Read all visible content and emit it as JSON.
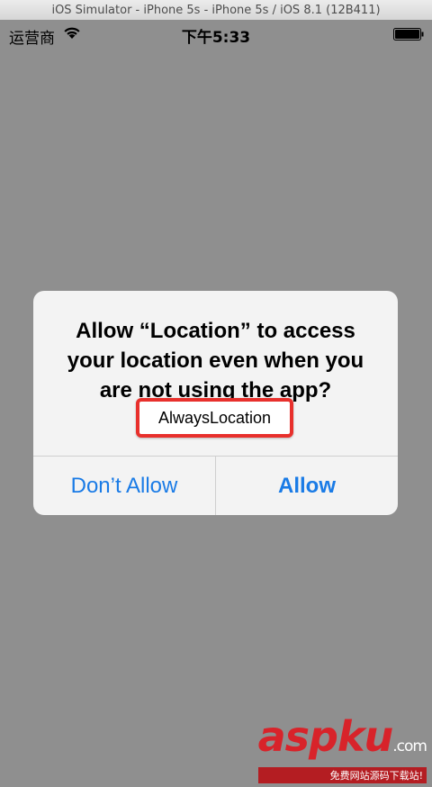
{
  "window": {
    "title": "iOS Simulator - iPhone 5s - iPhone 5s / iOS 8.1 (12B411)"
  },
  "statusbar": {
    "carrier": "运营商",
    "time": "下午5:33",
    "wifi_icon": "wifi-icon",
    "battery_icon": "battery-icon"
  },
  "alert": {
    "title": "Allow “Location” to access your location even when you are not using the app?",
    "message": "AlwaysLocation",
    "buttons": {
      "deny": "Don’t Allow",
      "allow": "Allow"
    },
    "button_color": "#1a7be6",
    "highlight_color": "#e8302c"
  },
  "watermark": {
    "logo": "aspku",
    "suffix": ".com",
    "tagline": "免费网站源码下载站!"
  }
}
